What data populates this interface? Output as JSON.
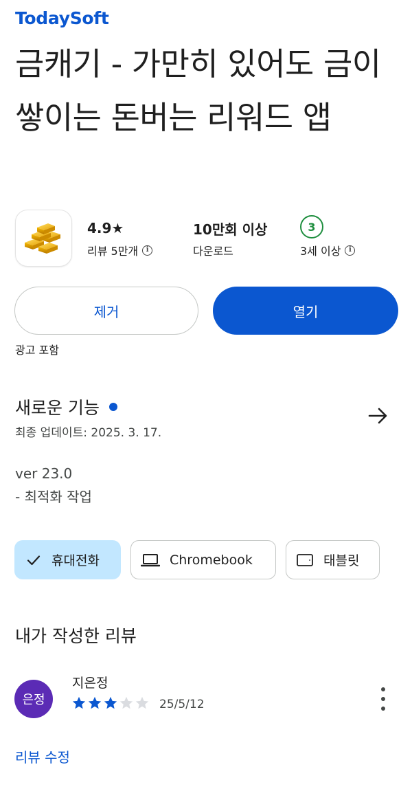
{
  "app": {
    "developer": "TodaySoft",
    "title": "금캐기 - 가만히 있어도 금이 쌓이는 돈버는 리워드 앱",
    "icon": "gold-bars-icon"
  },
  "stats": {
    "rating": {
      "value": "4.9★",
      "label": "리뷰 5만개"
    },
    "downloads": {
      "value": "10만회 이상",
      "label": "다운로드"
    },
    "age": {
      "badge": "3",
      "label": "3세 이상"
    }
  },
  "actions": {
    "uninstall_label": "제거",
    "open_label": "열기",
    "ads_note": "광고 포함"
  },
  "whats_new": {
    "title": "새로운 기능",
    "updated": "최종 업데이트: 2025. 3. 17.",
    "notes_line1": "ver 23.0",
    "notes_line2": "- 최적화 작업"
  },
  "devices": [
    {
      "label": "휴대전화",
      "icon": "check-icon",
      "selected": true
    },
    {
      "label": "Chromebook",
      "icon": "laptop-icon",
      "selected": false
    },
    {
      "label": "태블릿",
      "icon": "tablet-icon",
      "selected": false
    }
  ],
  "my_review": {
    "title": "내가 작성한 리뷰",
    "avatar_text": "은정",
    "reviewer": "지은정",
    "stars": 3,
    "max_stars": 5,
    "date": "25/5/12",
    "edit_label": "리뷰 수정"
  },
  "colors": {
    "accent": "#0b57d0",
    "chip_selected": "#c2e7ff",
    "age_green": "#1e8e3e",
    "avatar": "#5b2bb5",
    "star_empty": "#dadce0"
  }
}
